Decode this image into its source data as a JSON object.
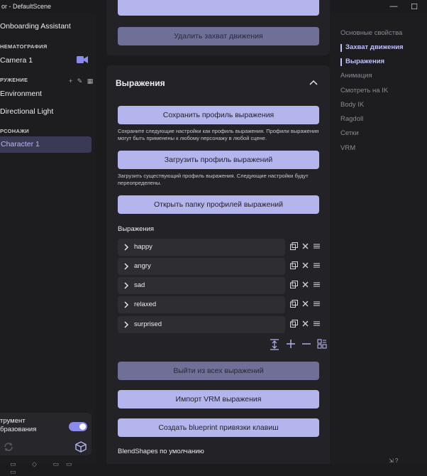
{
  "window": {
    "title": "or - DefaultScene",
    "minimize_glyph": "—",
    "maximize_glyph": "☐"
  },
  "sidebar": {
    "onboarding": "Onboarding Assistant",
    "section_cinematography": "НЕМАТОГРАФИЯ",
    "camera": "Camera 1",
    "section_environment": "РУЖЕНИЕ",
    "section_environment_icons": "+ ✎ ▦",
    "environment": "Environment",
    "directional_light": "Directional Light",
    "section_characters": "РСОНАЖИ",
    "character": "Character 1",
    "tool_label_line1": "трумент",
    "tool_label_line2": "бразования",
    "bottom_icons": "▭ ◇ ▭▭ ▭",
    "accent_color": "#8b8bec"
  },
  "main": {
    "top_card": {
      "remove_capture_button": "Удалить захват движения"
    },
    "expressions_card": {
      "title": "Выражения",
      "save_profile_button": "Сохранить профиль выражения",
      "save_profile_help": "Сохраните следующие настройки как профиль выражения. Профили выражения могут быть применены к любому персонажу в любой сцене.",
      "load_profile_button": "Загрузить профиль выражений",
      "load_profile_help": "Загрузить существующий профиль выражения. Следующие настройки будут переопределены.",
      "open_folder_button": "Открыть папку профилей выражений",
      "list_label": "Выражения",
      "expressions": [
        "happy",
        "angry",
        "sad",
        "relaxed",
        "surprised"
      ],
      "exit_all_button": "Выйти из всех выражений",
      "import_vrm_button": "Импорт VRM выражения",
      "create_blueprint_button": "Создать blueprint привязки клавиш",
      "blendshapes_label": "BlendShapes по умолчанию",
      "button_color": "#b5b5ee",
      "button_dim_color": "#6f6f97"
    }
  },
  "rightpanel": {
    "items": [
      {
        "label": "Основные свойства",
        "active": false
      },
      {
        "label": "Захват движения",
        "active": true
      },
      {
        "label": "Выражения",
        "active": true
      },
      {
        "label": "Анимация",
        "active": false
      },
      {
        "label": "Смотреть на IK",
        "active": false
      },
      {
        "label": "Body IK",
        "active": false
      },
      {
        "label": "Ragdoll",
        "active": false
      },
      {
        "label": "Сетки",
        "active": false
      },
      {
        "label": "VRM",
        "active": false
      }
    ],
    "bottom_glyph": "⇲ ?",
    "active_color": "#c2c2fb"
  }
}
